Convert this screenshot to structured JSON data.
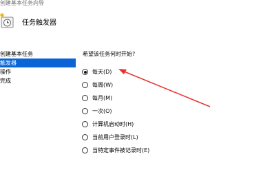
{
  "window": {
    "title": "创建基本任务向导"
  },
  "header": {
    "title": "任务触发器",
    "icon": "task-clock-icon"
  },
  "sidebar": {
    "items": [
      {
        "label": "创建基本任务",
        "selected": false
      },
      {
        "label": "触发器",
        "selected": true
      },
      {
        "label": "操作",
        "selected": false
      },
      {
        "label": "完成",
        "selected": false
      }
    ]
  },
  "main": {
    "question": "希望该任务何时开始?",
    "options": [
      {
        "label": "每天(D)",
        "checked": true
      },
      {
        "label": "每周(W)",
        "checked": false
      },
      {
        "label": "每月(M)",
        "checked": false
      },
      {
        "label": "一次(O)",
        "checked": false
      },
      {
        "label": "计算机启动时(H)",
        "checked": false
      },
      {
        "label": "当前用户登录时(L)",
        "checked": false
      },
      {
        "label": "当特定事件被记录时(E)",
        "checked": false
      }
    ]
  },
  "colors": {
    "selection": "#0a64d6",
    "annotation_arrow": "#e8312f"
  }
}
